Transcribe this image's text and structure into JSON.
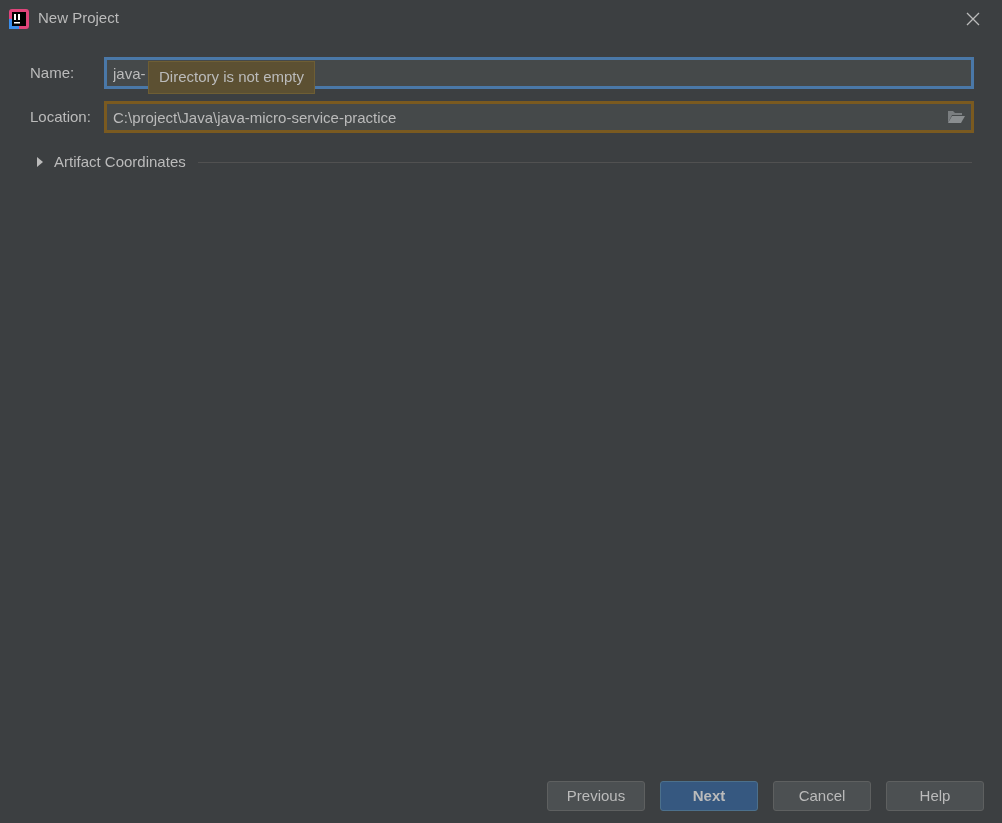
{
  "window": {
    "title": "New Project"
  },
  "fields": [
    {
      "label": "Name:",
      "value": "java-",
      "focused": true,
      "error": false,
      "tooltip": "Directory is not empty"
    },
    {
      "label": "Location:",
      "value": "C:\\project\\Java\\java-micro-service-practice",
      "focused": false,
      "error": true,
      "browse": true
    }
  ],
  "section": {
    "label": "Artifact Coordinates",
    "expanded": false
  },
  "buttons": [
    {
      "label": "Previous",
      "default": false
    },
    {
      "label": "Next",
      "default": true
    },
    {
      "label": "Cancel",
      "default": false
    },
    {
      "label": "Help",
      "default": false
    }
  ]
}
